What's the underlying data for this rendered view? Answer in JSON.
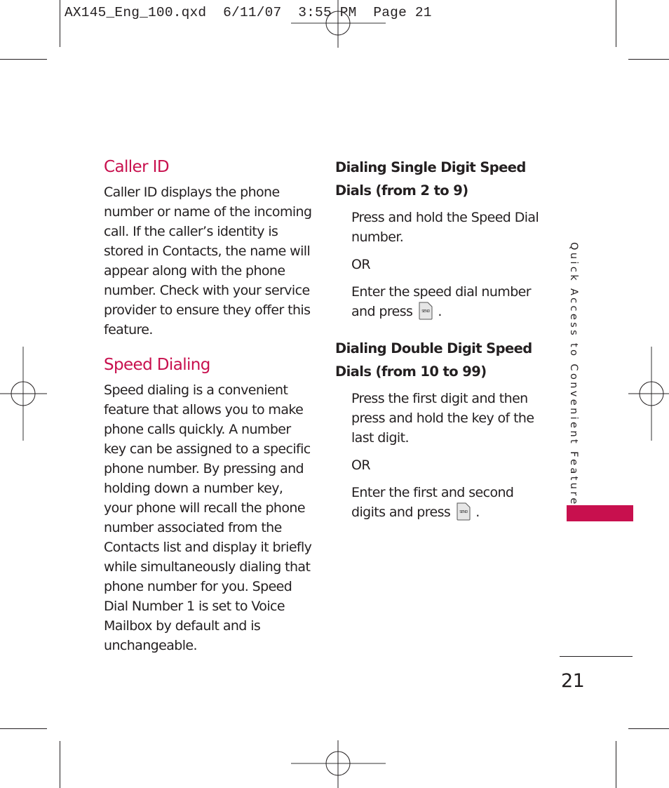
{
  "print_slug": "AX145_Eng_100.qxd  6/11/07  3:55 PM  Page 21",
  "accent_color": "#c8104e",
  "left_column": {
    "caller_id": {
      "heading": "Caller ID",
      "body": "Caller ID displays the phone number or name of the incoming call. If the caller’s identity is stored in Contacts, the name will appear along with the phone number. Check with your service provider to ensure they offer this feature."
    },
    "speed_dialing": {
      "heading": "Speed Dialing",
      "body": "Speed dialing is a convenient feature that allows you to make phone calls quickly. A number key can be assigned to a specific phone number.  By pressing and holding down a number key, your phone will recall the phone number associated from the Contacts list and display it briefly while simultaneously dialing that phone number for you.  Speed Dial Number 1 is set to Voice Mailbox by default and is unchangeable."
    }
  },
  "right_column": {
    "single_digit": {
      "heading_line1": "Dialing Single Digit Speed",
      "heading_line2": "Dials (from 2 to 9)",
      "step1": "Press and hold the Speed Dial number.",
      "or": "OR",
      "step2_text": "Enter the speed dial number and press",
      "step2_end": ".",
      "key_icon": "send-key-icon",
      "key_label": "SEND"
    },
    "double_digit": {
      "heading_line1": "Dialing Double Digit Speed",
      "heading_line2": "Dials (from 10 to 99)",
      "step1": "Press the first digit and then press and hold the key of the last digit.",
      "or": "OR",
      "step2_text": "Enter the first and second digits and press",
      "step2_end": ".",
      "key_icon": "send-key-icon",
      "key_label": "SEND"
    }
  },
  "side_tab": {
    "label": "Quick Access to Convenient Features"
  },
  "page_number": "21"
}
